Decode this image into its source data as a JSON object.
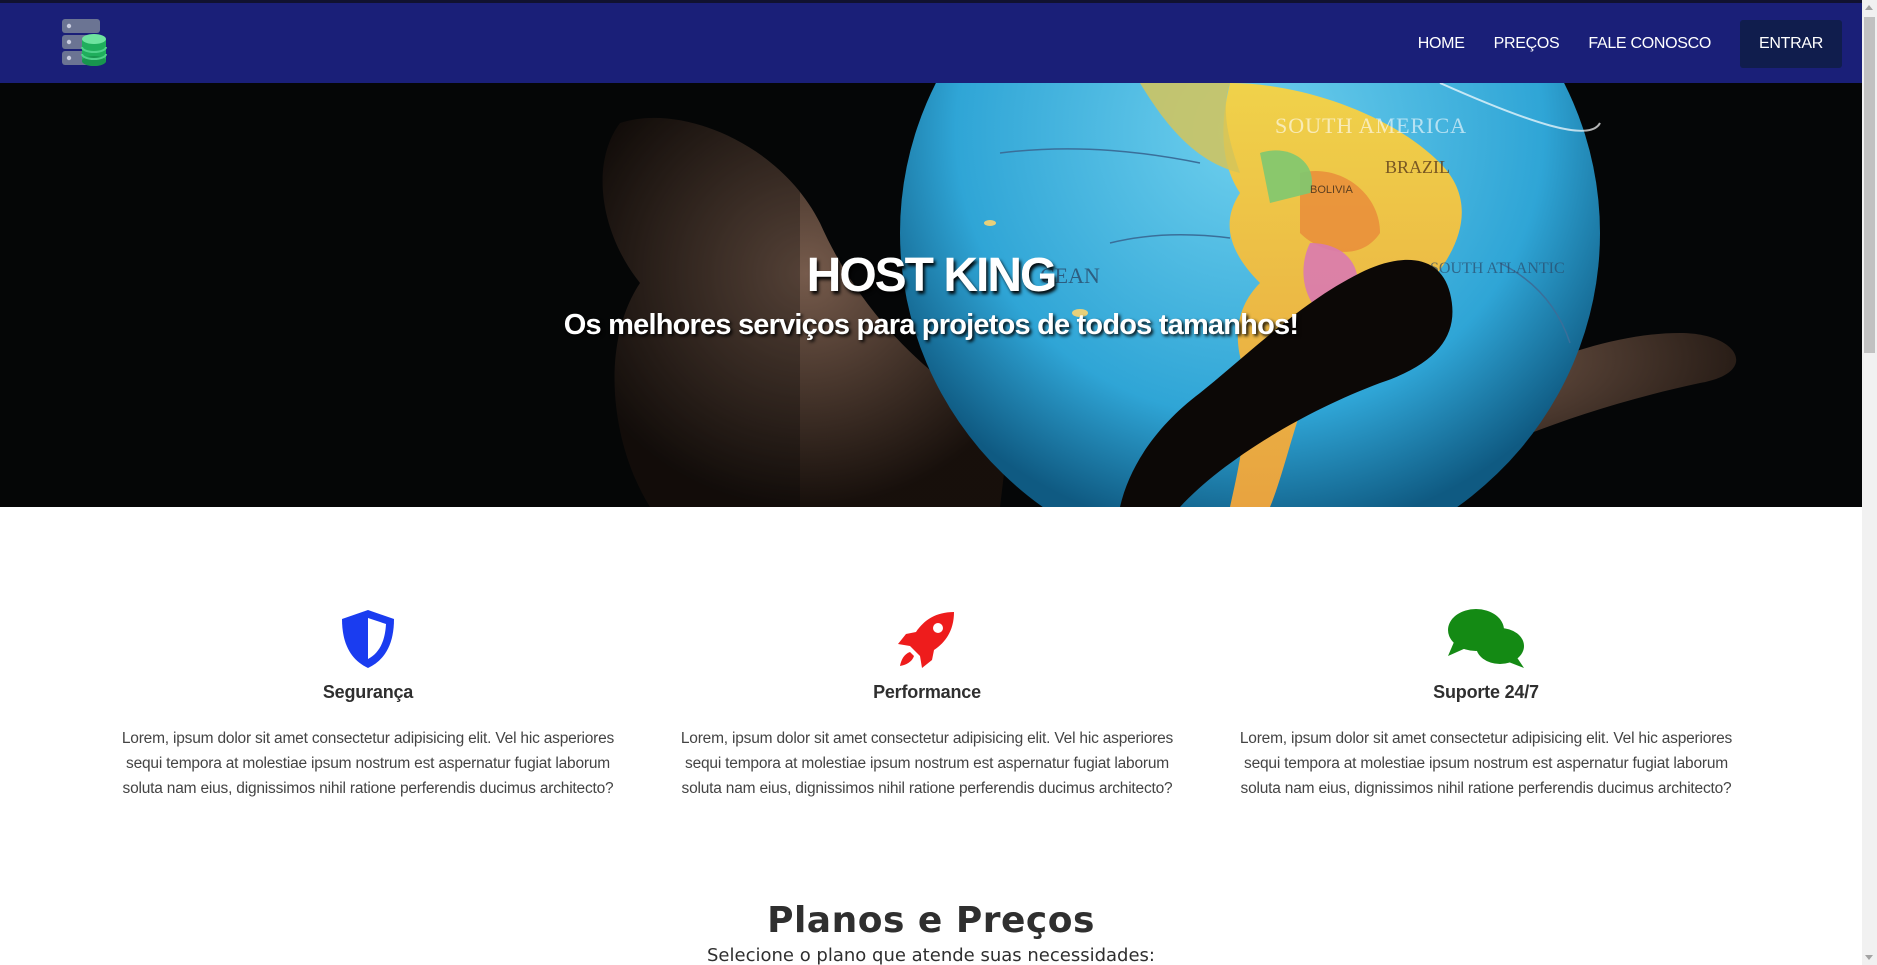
{
  "navbar": {
    "logo_icon": "server-database-icon",
    "links": [
      "HOME",
      "PREÇOS",
      "FALE CONOSCO"
    ],
    "login_label": "ENTRAR",
    "background": "#1a1f78"
  },
  "hero": {
    "title": "HOST KING",
    "subtitle": "Os melhores serviços para projetos de todos tamanhos!",
    "image": "hand-holding-globe"
  },
  "features": [
    {
      "icon": "shield-icon",
      "color": "#1a3cf0",
      "title": "Segurança",
      "text": "Lorem, ipsum dolor sit amet consectetur adipisicing elit. Vel hic asperiores sequi tempora at molestiae ipsum nostrum est aspernatur fugiat laborum soluta nam eius, dignissimos nihil ratione perferendis ducimus architecto?"
    },
    {
      "icon": "rocket-icon",
      "color": "#ee1c1c",
      "title": "Performance",
      "text": "Lorem, ipsum dolor sit amet consectetur adipisicing elit. Vel hic asperiores sequi tempora at molestiae ipsum nostrum est aspernatur fugiat laborum soluta nam eius, dignissimos nihil ratione perferendis ducimus architecto?"
    },
    {
      "icon": "chat-bubbles-icon",
      "color": "#148a14",
      "title": "Suporte 24/7",
      "text": "Lorem, ipsum dolor sit amet consectetur adipisicing elit. Vel hic asperiores sequi tempora at molestiae ipsum nostrum est aspernatur fugiat laborum soluta nam eius, dignissimos nihil ratione perferendis ducimus architecto?"
    }
  ],
  "pricing": {
    "title": "Planos e Preços",
    "subtitle": "Selecione o plano que atende suas necessidades:"
  }
}
